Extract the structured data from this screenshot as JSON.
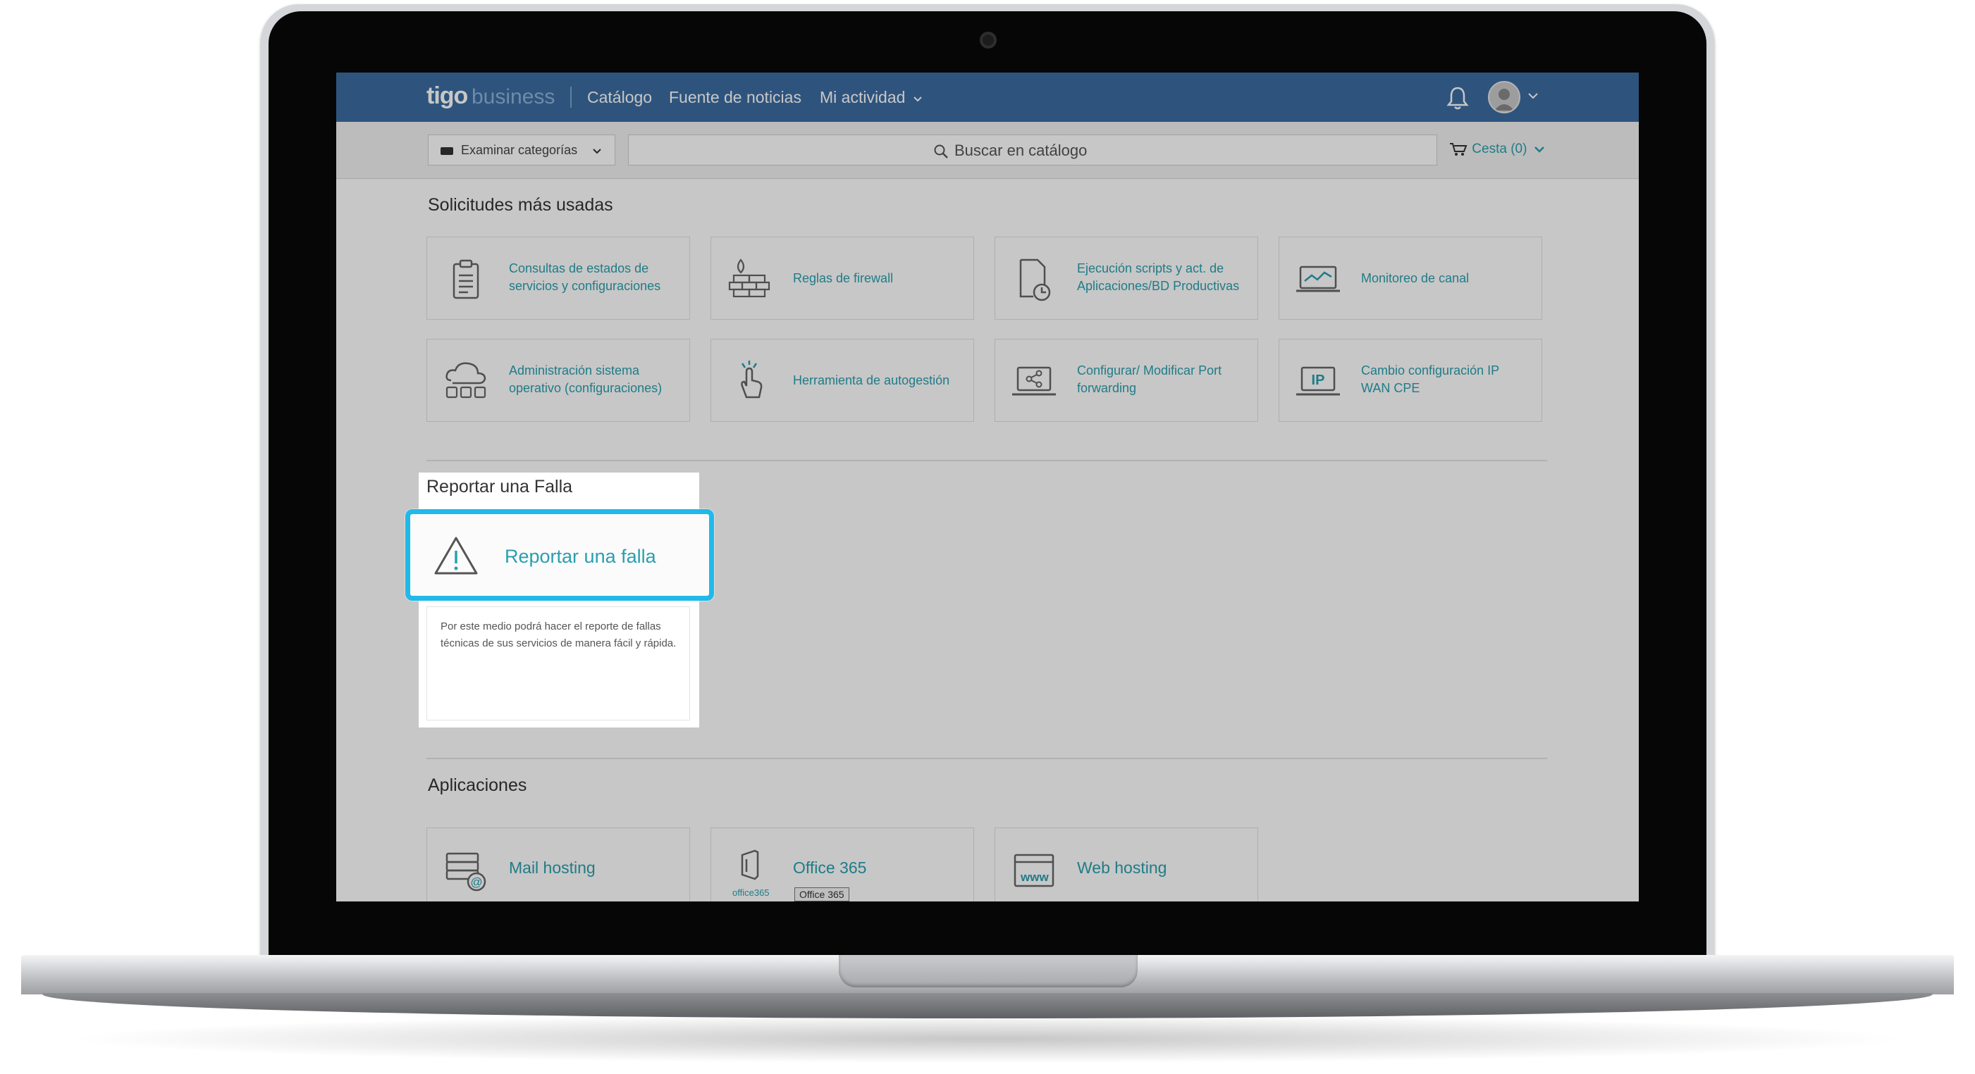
{
  "header": {
    "logo": "tigo",
    "logo_sub": "business",
    "nav": [
      "Catálogo",
      "Fuente de noticias",
      "Mi actividad"
    ],
    "icons": [
      "bell-icon",
      "user-avatar-icon",
      "chevron-down-icon"
    ]
  },
  "toolbar": {
    "browse_label": "Examinar categorías",
    "search_placeholder": "Buscar en catálogo",
    "cart_label": "Cesta (0)"
  },
  "sections": {
    "most_used": {
      "title": "Solicitudes más usadas",
      "items": [
        {
          "label": "Consultas de estados de servicios y configuraciones",
          "icon": "clipboard-icon"
        },
        {
          "label": "Reglas de firewall",
          "icon": "firewall-icon"
        },
        {
          "label": "Ejecución scripts y act. de Aplicaciones/BD Productivas",
          "icon": "document-clock-icon"
        },
        {
          "label": "Monitoreo de canal",
          "icon": "monitor-chart-icon"
        },
        {
          "label": "Administración sistema operativo (configuraciones)",
          "icon": "cloud-servers-icon"
        },
        {
          "label": "Herramienta de autogestión",
          "icon": "hand-pointer-icon"
        },
        {
          "label": "Configurar/ Modificar Port forwarding",
          "icon": "laptop-share-icon"
        },
        {
          "label": "Cambio configuración IP WAN CPE",
          "icon": "laptop-ip-icon"
        }
      ]
    },
    "report": {
      "title": "Reportar una Falla",
      "card_label": "Reportar una falla",
      "description": "Por este medio podrá hacer el reporte de fallas técnicas de sus servicios de manera fácil y rápida.",
      "icon": "warning-icon"
    },
    "apps": {
      "title": "Aplicaciones",
      "items": [
        {
          "label": "Mail hosting",
          "icon": "mail-server-icon"
        },
        {
          "label": "Office 365",
          "icon": "office365-icon",
          "icon_text": "office365",
          "tooltip": "Office 365"
        },
        {
          "label": "Web hosting",
          "icon": "www-icon",
          "icon_text": "www"
        }
      ]
    }
  },
  "colors": {
    "nav_bg": "#3c6ca0",
    "link": "#2a9fae",
    "highlight": "#21b9ea"
  }
}
